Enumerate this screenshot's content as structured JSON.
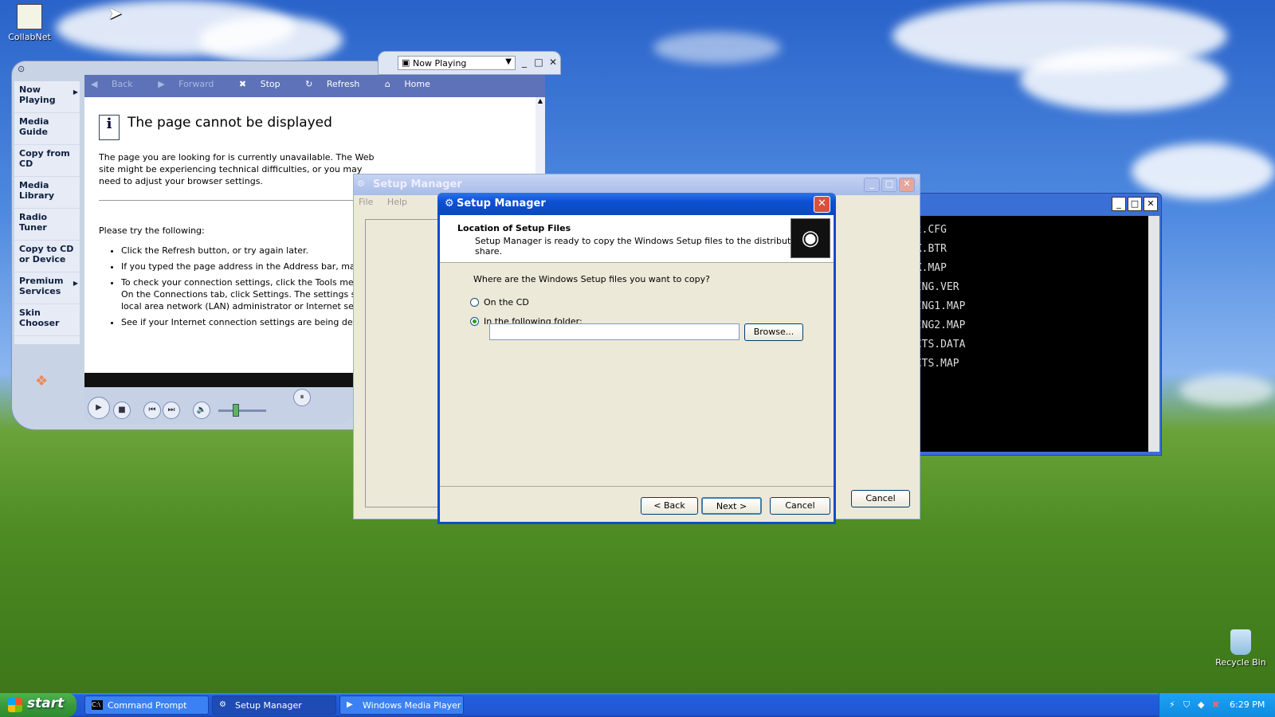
{
  "desktop": {
    "icons": [
      {
        "label": "CollabNet"
      },
      {
        "label": "Recycle Bin"
      }
    ]
  },
  "wmp": {
    "now_playing_select": "Now Playing",
    "tasks": [
      {
        "label": "Now Playing"
      },
      {
        "label": "Media Guide"
      },
      {
        "label": "Copy from CD"
      },
      {
        "label": "Media Library"
      },
      {
        "label": "Radio Tuner"
      },
      {
        "label": "Copy to CD or Device"
      },
      {
        "label": "Premium Services"
      },
      {
        "label": "Skin Chooser"
      }
    ],
    "toolbar": {
      "back": "Back",
      "forward": "Forward",
      "stop": "Stop",
      "refresh": "Refresh",
      "home": "Home"
    },
    "page": {
      "title": "The page cannot be displayed",
      "intro": "The page you are looking for is currently unavailable. The Web site might be experiencing technical difficulties, or you may need to adjust your browser settings.",
      "try": "Please try the following:",
      "bullets": [
        "Click the  Refresh button, or try again later.",
        "If you typed the page address in the Address bar, make sure that it is spelled correctly.",
        "To check your connection settings, click the Tools menu, and then click Internet Options. On the Connections tab, click Settings. The settings should match those provided by your local area network (LAN) administrator or Internet service provider (ISP).",
        "See if your Internet connection settings are being detected."
      ]
    }
  },
  "cmd": {
    "lines": [
      "mt.CFG",
      "EX.BTR",
      "EX.MAP",
      "PING.VER",
      "PING1.MAP",
      "PING2.MAP",
      "ECTS.DATA",
      "ECTS.MAP"
    ]
  },
  "setup_bg": {
    "title": "Setup Manager",
    "menu": [
      "File",
      "Help"
    ],
    "cancel": "Cancel"
  },
  "dialog": {
    "title": "Setup Manager",
    "header_title": "Location of Setup Files",
    "header_sub": "Setup Manager is ready to copy the Windows Setup files to the distribution share.",
    "question": "Where are the Windows Setup files you want to copy?",
    "options": [
      {
        "label": "On the CD",
        "selected": false
      },
      {
        "label": "In the following folder:",
        "selected": true
      }
    ],
    "folder_value": "",
    "browse": "Browse...",
    "back": "< Back",
    "next": "Next >",
    "cancel": "Cancel"
  },
  "taskbar": {
    "start": "start",
    "buttons": [
      {
        "label": "Command Prompt"
      },
      {
        "label": "Setup Manager"
      },
      {
        "label": "Windows Media Player"
      }
    ],
    "clock": "6:29 PM"
  }
}
